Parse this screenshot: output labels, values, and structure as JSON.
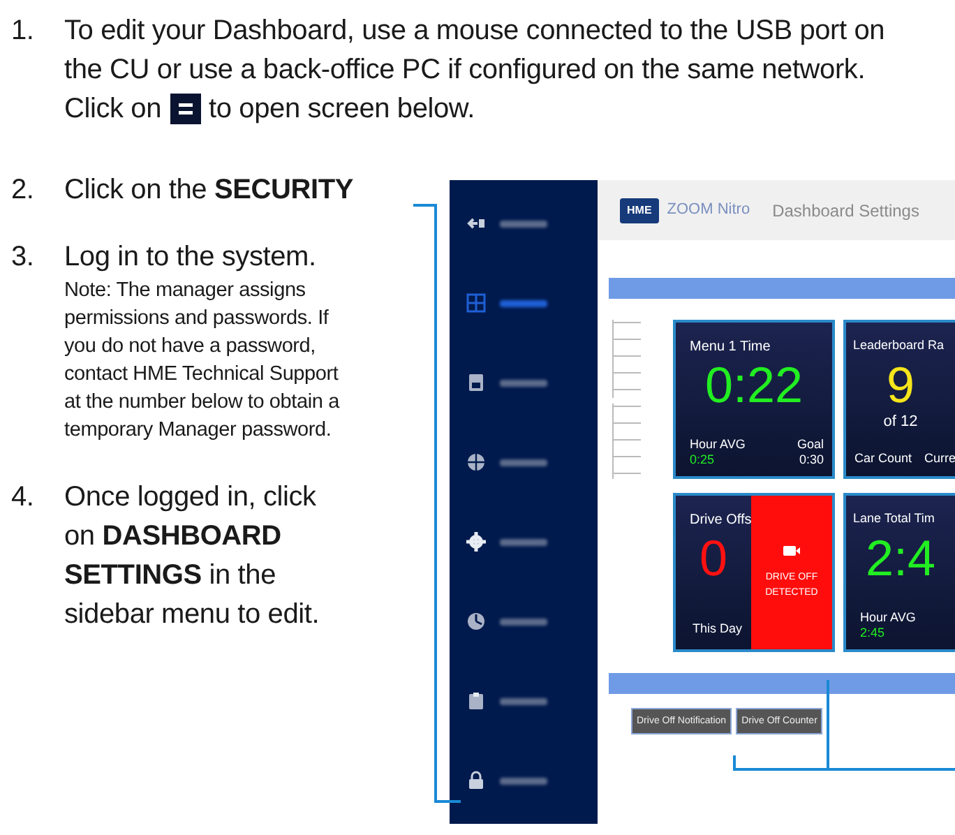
{
  "steps": [
    {
      "number": "1.",
      "text": "To edit your Dashboard, use a mouse connected to the USB port on the CU or use a back-office PC if configured on the same network.",
      "text_before": "Click on",
      "text_after": "to open screen below."
    },
    {
      "number": "2.",
      "text": "Click on the **SECURITY**"
    },
    {
      "number": "3.",
      "text": "Log in to the system.",
      "note": "Note: The manager assigns permissions and passwords. If you do not have a password, contact HME Technical Support at the number below to obtain a temporary Manager password."
    },
    {
      "number": "4.",
      "text": "Once logged in, click on **DASHBOARD SETTINGS** in the sidebar menu to edit."
    }
  ],
  "screenshot": {
    "header": {
      "logo": "HME",
      "product": "ZOOM Nitro",
      "title": "Dashboard Settings"
    },
    "sidebar": {
      "items": [
        {
          "selected": false
        },
        {
          "selected": true
        },
        {
          "selected": false
        },
        {
          "selected": false
        },
        {
          "selected": false
        },
        {
          "selected": false
        },
        {
          "selected": false
        },
        {
          "selected": false
        }
      ]
    },
    "tiles": [
      {
        "kind": "timer",
        "title": "Menu 1 Time",
        "value": "0:22",
        "color": "#22ee22",
        "left_label": "Hour AVG",
        "left_value": "0:25",
        "right_label": "Goal",
        "right_value": "0:30"
      },
      {
        "kind": "rank",
        "title": "Leaderboard Ra",
        "value": "9",
        "color": "#f5e51b",
        "sub": "of 12",
        "left_label": "Car Count",
        "right_label": "Curre"
      },
      {
        "kind": "alert",
        "title": "Drive Offs",
        "value": "0",
        "color": "#ff1111",
        "left_label": "This Day",
        "alert": "DRIVE OFF DETECTED"
      },
      {
        "kind": "timer",
        "title": "Lane Total Tim",
        "value": "2:4",
        "color": "#22ee22",
        "left_label": "Hour AVG",
        "left_value": "2:45"
      }
    ],
    "buttons": [
      "Drive Off Notification",
      "Drive Off Counter"
    ]
  }
}
